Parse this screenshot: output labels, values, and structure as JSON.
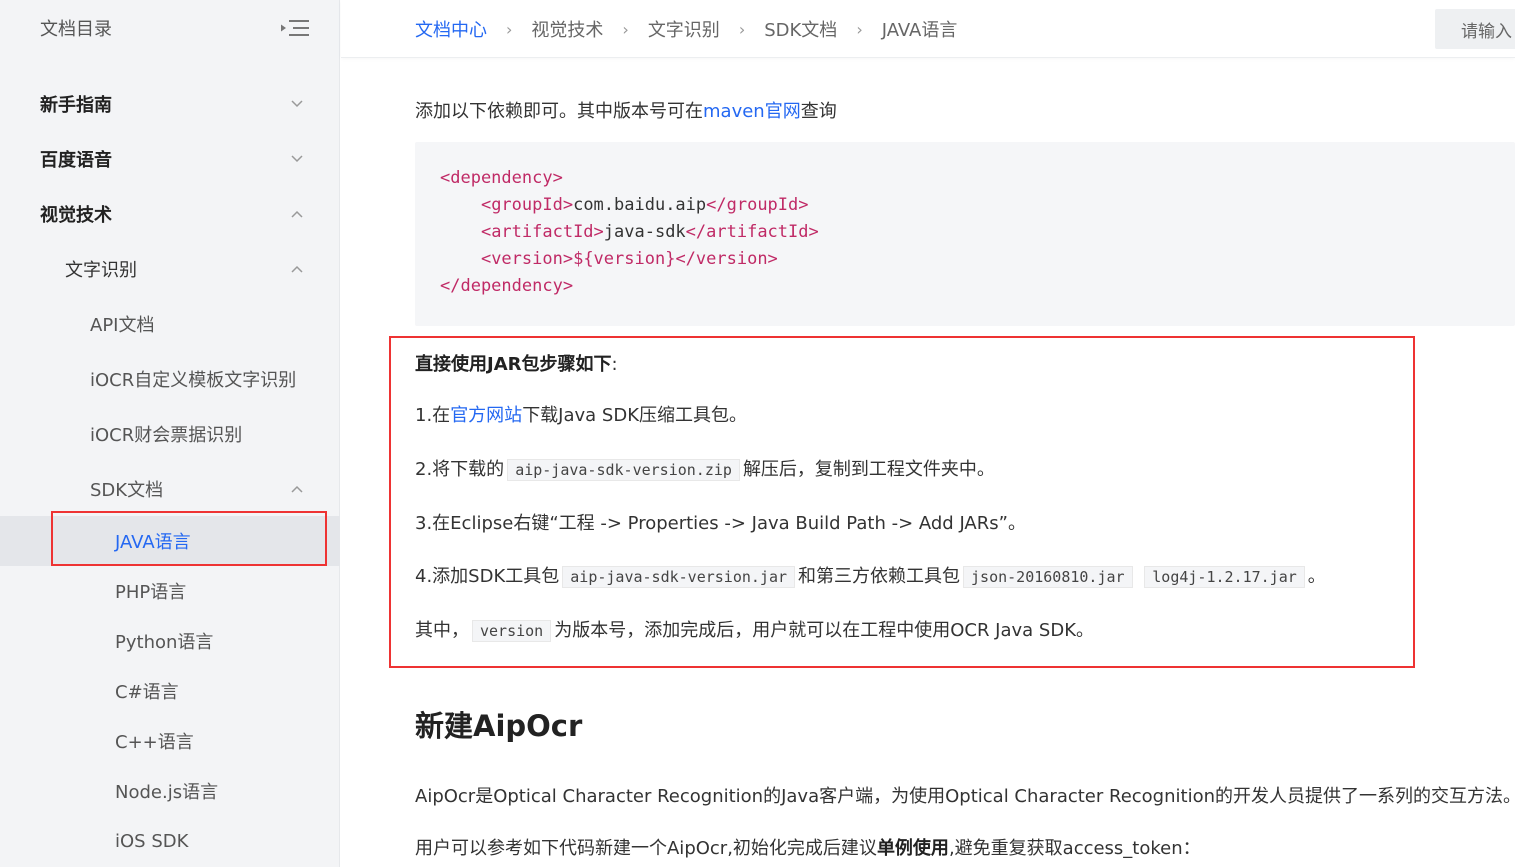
{
  "sidebar": {
    "title": "文档目录",
    "items": [
      {
        "label": "新手指南",
        "level": 1,
        "expanded": false
      },
      {
        "label": "百度语音",
        "level": 1,
        "expanded": false
      },
      {
        "label": "视觉技术",
        "level": 1,
        "expanded": true
      },
      {
        "label": "文字识别",
        "level": 2,
        "expanded": true
      },
      {
        "label": "API文档",
        "level": 3
      },
      {
        "label": "iOCR自定义模板文字识别",
        "level": 3
      },
      {
        "label": "iOCR财会票据识别",
        "level": 3
      },
      {
        "label": "SDK文档",
        "level": 3,
        "expanded": true
      },
      {
        "label": "JAVA语言",
        "level": 4,
        "active": true
      },
      {
        "label": "PHP语言",
        "level": 4
      },
      {
        "label": "Python语言",
        "level": 4
      },
      {
        "label": "C#语言",
        "level": 4
      },
      {
        "label": "C++语言",
        "level": 4
      },
      {
        "label": "Node.js语言",
        "level": 4
      },
      {
        "label": "iOS SDK",
        "level": 4
      }
    ]
  },
  "breadcrumb": [
    "文档中心",
    "视觉技术",
    "文字识别",
    "SDK文档",
    "JAVA语言"
  ],
  "search": {
    "placeholder": "请输入"
  },
  "content": {
    "intro_before": "添加以下依赖即可。其中版本号可在",
    "intro_link": "maven官网",
    "intro_after": "查询",
    "code": {
      "open_dependency": "<dependency>",
      "group_open": "<groupId>",
      "group_value": "com.baidu.aip",
      "group_close": "</groupId>",
      "artifact_open": "<artifactId>",
      "artifact_value": "java-sdk",
      "artifact_close": "</artifactId>",
      "version_open": "<version>",
      "version_value": "${version}",
      "version_close": "</version>",
      "close_dependency": "</dependency>"
    },
    "jar_heading": "直接使用JAR包步骤如下",
    "jar_heading_colon": ":",
    "step1_before": "1.在",
    "step1_link": "官方网站",
    "step1_after": "下载Java SDK压缩工具包。",
    "step2_before": "2.将下载的",
    "step2_code": "aip-java-sdk-version.zip",
    "step2_after": "解压后，复制到工程文件夹中。",
    "step3": "3.在Eclipse右键“工程 -> Properties -> Java Build Path -> Add JARs”。",
    "step4_before": "4.添加SDK工具包",
    "step4_code1": "aip-java-sdk-version.jar",
    "step4_mid": "和第三方依赖工具包",
    "step4_code2": "json-20160810.jar",
    "step4_code3": "log4j-1.2.17.jar",
    "step4_after": "。",
    "note_before": "其中，",
    "note_code": "version",
    "note_after": "为版本号，添加完成后，用户就可以在工程中使用OCR Java SDK。",
    "section_title": "新建AipOcr",
    "desc": "AipOcr是Optical Character Recognition的Java客户端，为使用Optical Character Recognition的开发人员提供了一系列的交互方法。",
    "usage_before": "用户可以参考如下代码新建一个AipOcr,初始化完成后建议",
    "usage_bold": "单例使用",
    "usage_after": ",避免重复获取access_token："
  },
  "colors": {
    "accent": "#2468f2",
    "highlight_border": "#e33",
    "tag": "#c02a66"
  },
  "icons": {
    "collapse": "menu-collapse-icon",
    "chevron_down": "chevron-down-icon",
    "chevron_up": "chevron-up-icon",
    "separator": "chevron-right-icon"
  }
}
